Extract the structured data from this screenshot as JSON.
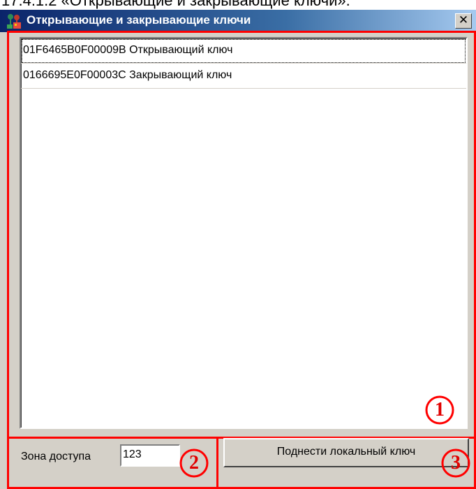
{
  "caption": "17.4.1.2 «Открывающие и закрывающие ключи».",
  "window": {
    "title": "Открывающие и закрывающие ключи",
    "app_icon": "keys-app-icon",
    "close_icon": "close-icon",
    "close_glyph": "✕"
  },
  "key_list": {
    "items": [
      {
        "label": "01F6465B0F00009B Открывающий ключ",
        "focused": true
      },
      {
        "label": "0166695E0F00003C Закрывающий ключ",
        "focused": false
      }
    ]
  },
  "zone": {
    "label": "Зона доступа",
    "value": "123"
  },
  "action_button": {
    "label": "Поднести локальный ключ"
  },
  "markers": [
    "1",
    "2",
    "3"
  ],
  "colors": {
    "annotation": "#ff0000",
    "title_bar_start": "#0a246a",
    "title_bar_end": "#a6caf0",
    "window_face": "#d4d0c8"
  }
}
